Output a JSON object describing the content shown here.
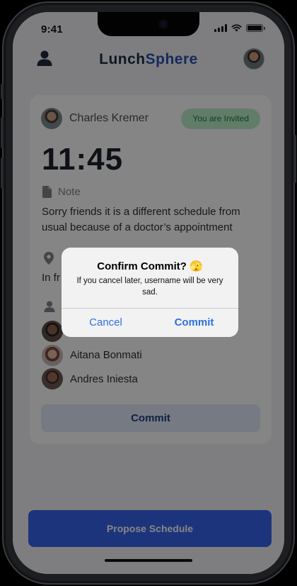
{
  "status_bar": {
    "time": "9:41"
  },
  "header": {
    "title_prefix": "Lunch",
    "title_accent": "Sphere"
  },
  "event": {
    "host_name": "Charles Kremer",
    "invite_badge": "You are Invited",
    "time": "11:45",
    "note_label": "Note",
    "note_text": "Sorry friends it is a different schedule from usual because of a doctor’s appointment",
    "location_text": "In fr",
    "attendees": [
      "",
      "Aitana Bonmati",
      "Andres Iniesta"
    ],
    "commit_label": "Commit"
  },
  "propose_button": "Propose Schedule",
  "dialog": {
    "title": "Confirm Commit? 🫣",
    "message": "If you cancel later, username will be very sad.",
    "cancel_label": "Cancel",
    "commit_label": "Commit"
  },
  "colors": {
    "brand_accent": "#2a4fb0",
    "primary_button": "#3562e8",
    "invite_badge_bg": "#b8ecc6",
    "invite_badge_text": "#1f7a3c",
    "dialog_action": "#2d6fe0"
  }
}
